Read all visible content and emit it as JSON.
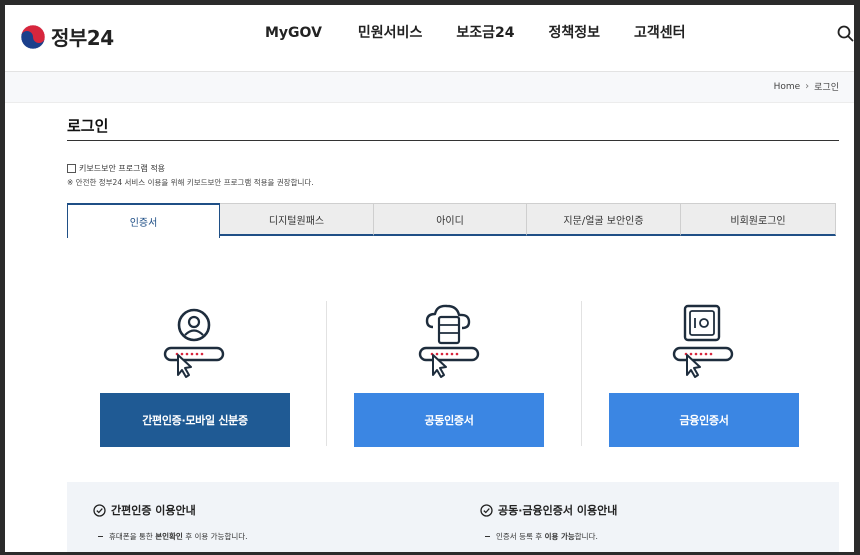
{
  "header": {
    "logo_text": "정부24",
    "nav": [
      "MyGOV",
      "민원서비스",
      "보조금24",
      "정책정보",
      "고객센터"
    ]
  },
  "breadcrumb": {
    "home": "Home",
    "current": "로그인"
  },
  "page": {
    "title": "로그인",
    "keyboard_security_label": "키보드보안 프로그램 적용",
    "keyboard_security_note": "※ 안전한 정부24 서비스 이용을 위해 키보드보안 프로그램 적용을 권장합니다."
  },
  "tabs": [
    "인증서",
    "디지털원패스",
    "아이디",
    "지문/얼굴 보안인증",
    "비회원로그인"
  ],
  "cards": [
    {
      "label": "간편인증·모바일 신분증",
      "color": "#1f5a94",
      "icon": "person-key-icon"
    },
    {
      "label": "공동인증서",
      "color": "#3b86e3",
      "icon": "cloud-server-key-icon"
    },
    {
      "label": "금융인증서",
      "color": "#3b86e3",
      "icon": "safe-key-icon"
    }
  ],
  "info": {
    "left": {
      "title": "간편인증 이용안내",
      "bullet_pre": "휴대폰을 통한",
      "bullet_bold": "본인확인",
      "bullet_post": "후 이용 가능합니다."
    },
    "right": {
      "title": "공동·금융인증서 이용안내",
      "bullet_pre": "인증서 등록 후",
      "bullet_bold": "이용 가능",
      "bullet_post": "합니다."
    }
  },
  "colors": {
    "primary_dark": "#1f5a94",
    "primary": "#3b86e3",
    "accent_red": "#d7263d",
    "navy": "#1f4f86"
  }
}
